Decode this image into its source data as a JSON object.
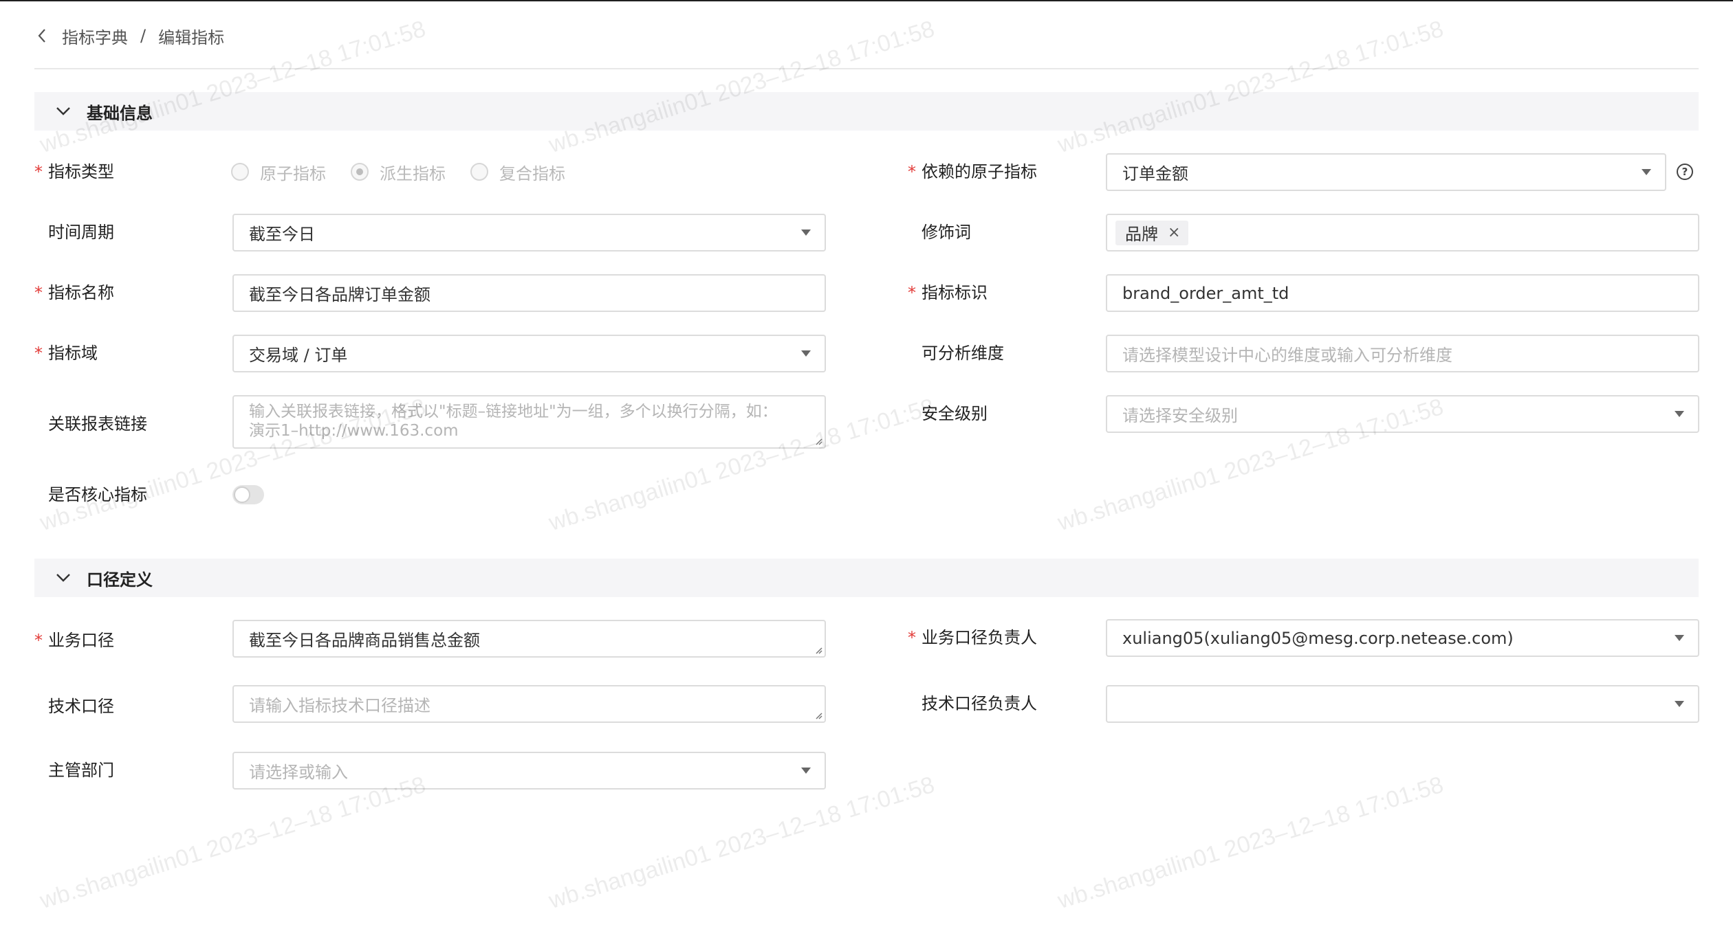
{
  "breadcrumb": {
    "parent": "指标字典",
    "separator": "/",
    "current": "编辑指标"
  },
  "sections": {
    "basic": "基础信息",
    "caliber": "口径定义"
  },
  "fields": {
    "metric_type": {
      "label": "指标类型",
      "required": true,
      "options": [
        "原子指标",
        "派生指标",
        "复合指标"
      ],
      "selected": "派生指标",
      "disabled": true
    },
    "atomic_metric": {
      "label": "依赖的原子指标",
      "required": true,
      "value": "订单金额"
    },
    "time_period": {
      "label": "时间周期",
      "required": false,
      "value": "截至今日"
    },
    "modifier": {
      "label": "修饰词",
      "required": false,
      "tags": [
        "品牌"
      ]
    },
    "metric_name": {
      "label": "指标名称",
      "required": true,
      "value": "截至今日各品牌订单金额"
    },
    "metric_id": {
      "label": "指标标识",
      "required": true,
      "value": "brand_order_amt_td"
    },
    "metric_domain": {
      "label": "指标域",
      "required": true,
      "value": "交易域 / 订单"
    },
    "dimensions": {
      "label": "可分析维度",
      "required": false,
      "placeholder": "请选择模型设计中心的维度或输入可分析维度"
    },
    "report_links": {
      "label": "关联报表链接",
      "required": false,
      "placeholder_line1": "输入关联报表链接，格式以\"标题–链接地址\"为一组，多个以换行分隔，如：",
      "placeholder_line2": "演示1–http://www.163.com"
    },
    "security_level": {
      "label": "安全级别",
      "required": false,
      "placeholder": "请选择安全级别"
    },
    "is_core": {
      "label": "是否核心指标",
      "required": false,
      "enabled": false
    },
    "business_caliber": {
      "label": "业务口径",
      "required": true,
      "value": "截至今日各品牌商品销售总金额"
    },
    "business_owner": {
      "label": "业务口径负责人",
      "required": true,
      "value": "xuliang05(xuliang05@mesg.corp.netease.com)"
    },
    "tech_caliber": {
      "label": "技术口径",
      "required": false,
      "placeholder": "请输入指标技术口径描述"
    },
    "tech_owner": {
      "label": "技术口径负责人",
      "required": false,
      "value": ""
    },
    "department": {
      "label": "主管部门",
      "required": false,
      "placeholder": "请选择或输入"
    }
  },
  "required_mark": "*",
  "tag_remove_symbol": "×",
  "help_symbol": "?",
  "watermark": "wb.shangailin01 2023–12–18 17:01:58",
  "colors": {
    "required": "#e23c39",
    "section_bg": "#f5f5f7",
    "border": "#dcdcdc",
    "placeholder": "#b5b5b5"
  }
}
